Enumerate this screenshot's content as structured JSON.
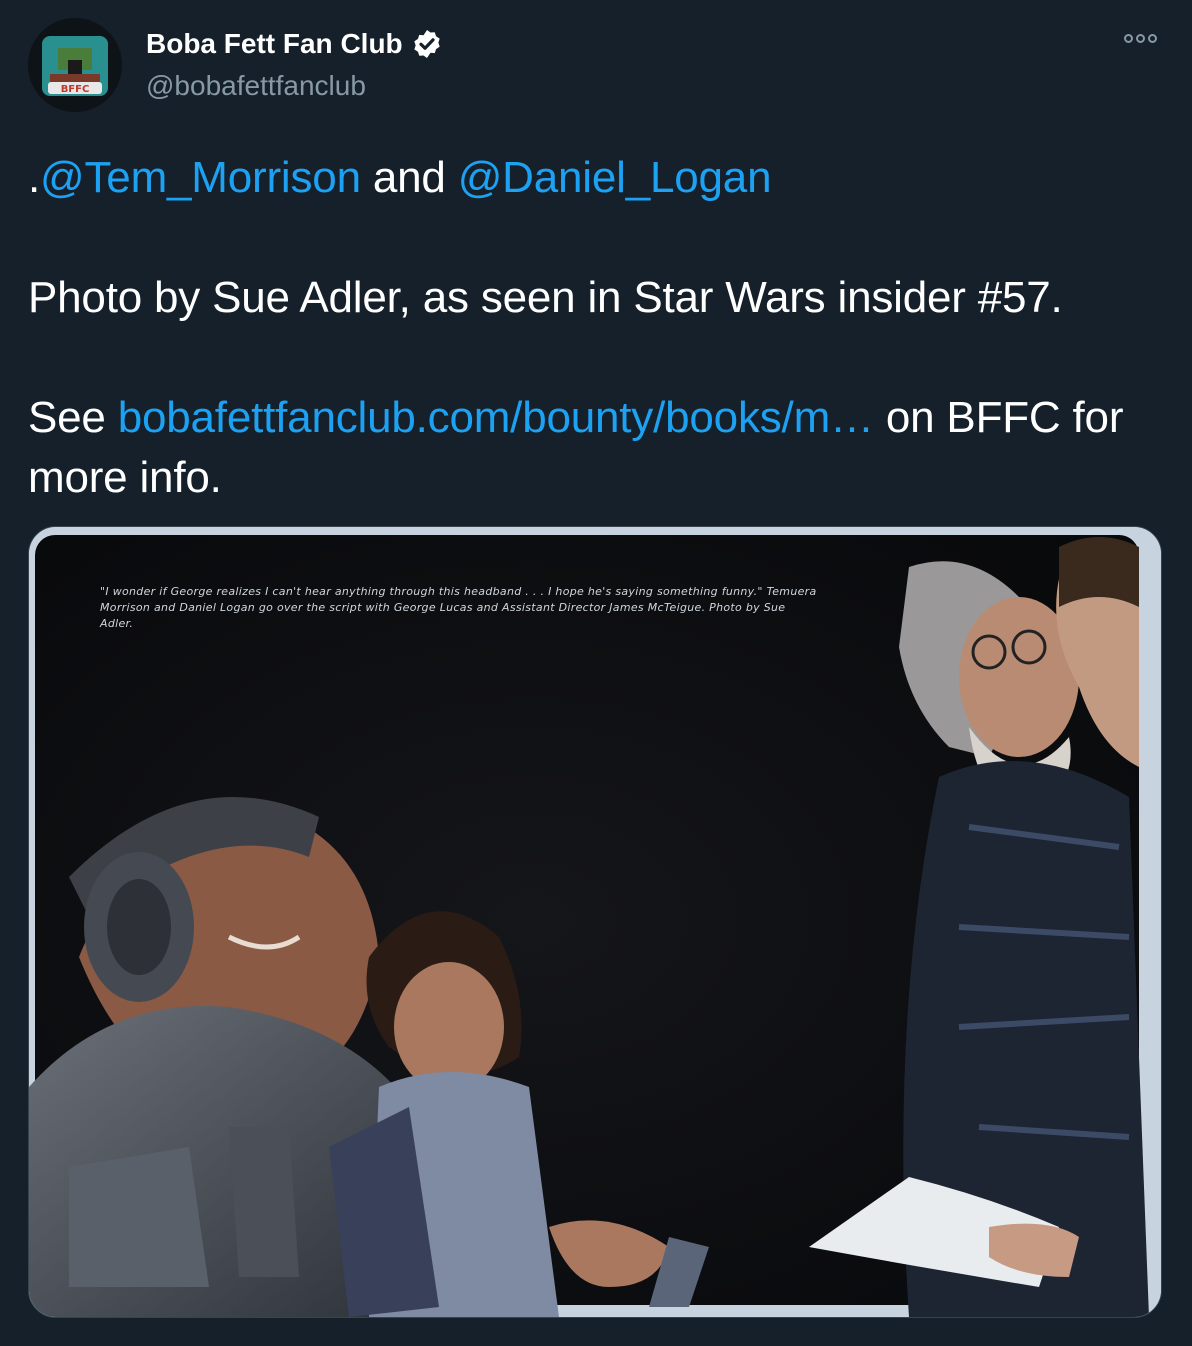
{
  "tweet": {
    "display_name": "Boba Fett Fan Club",
    "handle": "@bobafettfanclub",
    "avatar_badge": "BFFC",
    "verified": true,
    "mention_prefix": ".",
    "mention_1": "@Tem_Morrison",
    "and_text": " and ",
    "mention_2": "@Daniel_Logan",
    "paragraph_2": "Photo by Sue Adler, as seen in Star Wars insider #57.",
    "see_text": "See ",
    "link_text": "bobafettfanclub.com/bounty/books/m…",
    "after_link": " on BFFC for more info."
  },
  "media": {
    "caption": "\"I wonder if George realizes I can't hear anything through this headband . . . I hope he's saying something funny.\" Temuera Morrison and Daniel Logan go over the script with George Lucas and Assistant Director James McTeigue. Photo by Sue Adler."
  },
  "icons": {
    "more": "more-options-icon",
    "verified": "verified-badge-icon"
  },
  "colors": {
    "background": "#15202b",
    "link": "#1da1f2",
    "secondary_text": "#8899a6"
  }
}
